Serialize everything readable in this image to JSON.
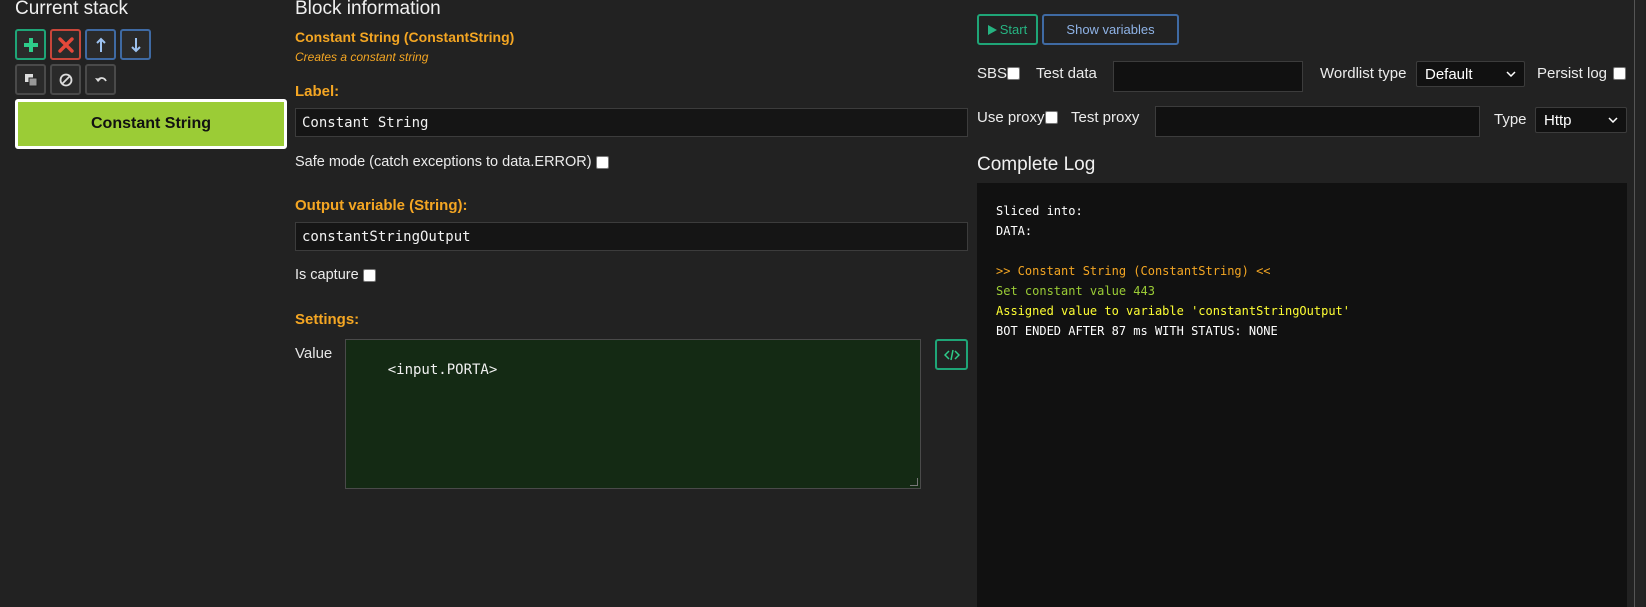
{
  "stack": {
    "title": "Current stack",
    "tools": [
      {
        "name": "add-block-icon",
        "color": "#1fa577"
      },
      {
        "name": "delete-block-icon",
        "color": "#c8463a"
      },
      {
        "name": "move-up-icon",
        "color": "#3f6aa3"
      },
      {
        "name": "move-down-icon",
        "color": "#3f6aa3"
      },
      {
        "name": "clone-block-icon",
        "color": "#4a4a4a"
      },
      {
        "name": "disable-block-icon",
        "color": "#4a4a4a"
      },
      {
        "name": "undo-icon",
        "color": "#4a4a4a"
      }
    ],
    "blocks": [
      {
        "label": "Constant String",
        "color": "#9bcc36"
      }
    ]
  },
  "block_info": {
    "title": "Block information",
    "name": "Constant String (ConstantString)",
    "description": "Creates a constant string",
    "label_heading": "Label:",
    "label_value": "Constant String",
    "safe_mode_text": "Safe mode (catch exceptions to data.ERROR)",
    "safe_mode_checked": false,
    "output_heading": "Output variable (String):",
    "output_value": "constantStringOutput",
    "is_capture_text": "Is capture",
    "is_capture_checked": false,
    "settings_heading": "Settings:",
    "value_label": "Value",
    "value_text": "<input.PORTA>"
  },
  "debugger": {
    "start_label": "Start",
    "show_variables_label": "Show variables",
    "sbs_label": "SBS",
    "test_data_label": "Test data",
    "test_data_value": "",
    "wordlist_type_label": "Wordlist type",
    "wordlist_type_value": "Default",
    "persist_log_label": "Persist log",
    "use_proxy_label": "Use proxy",
    "test_proxy_label": "Test proxy",
    "test_proxy_value": "",
    "type_label": "Type",
    "type_value": "Http",
    "log_title": "Complete Log",
    "log_lines": [
      {
        "text": "Sliced into:",
        "color": "#ffffff"
      },
      {
        "text": "DATA:",
        "color": "#ffffff"
      },
      {
        "text": "",
        "color": "#ffffff"
      },
      {
        "text": ">> Constant String (ConstantString) <<",
        "color": "#f4a623"
      },
      {
        "text": "Set constant value 443",
        "color": "#9bcc36"
      },
      {
        "text": "Assigned value to variable 'constantStringOutput'",
        "color": "#ffff33"
      },
      {
        "text": "BOT ENDED AFTER 87 ms WITH STATUS: NONE",
        "color": "#ffffff"
      }
    ]
  }
}
